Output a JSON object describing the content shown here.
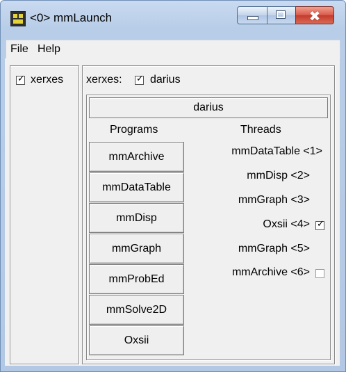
{
  "window": {
    "title": "<0> mmLaunch",
    "app_icon": "mm-app-icon"
  },
  "titlebar_buttons": {
    "minimize": "minimize-icon",
    "maximize": "maximize-icon",
    "close_glyph": "✖"
  },
  "menu": {
    "items": [
      "File",
      "Help"
    ]
  },
  "hosts": [
    {
      "label": "xerxes",
      "checked": true
    }
  ],
  "host_panel": {
    "prefix": "xerxes:",
    "node_label": "darius",
    "node_checked": true
  },
  "node": {
    "header": "darius",
    "programs_heading": "Programs",
    "threads_heading": "Threads",
    "programs": [
      "mmArchive",
      "mmDataTable",
      "mmDisp",
      "mmGraph",
      "mmProbEd",
      "mmSolve2D",
      "Oxsii"
    ],
    "threads": [
      {
        "label": "mmDataTable <1>",
        "checkbox": null
      },
      {
        "label": "mmDisp <2>",
        "checkbox": null
      },
      {
        "label": "mmGraph <3>",
        "checkbox": null
      },
      {
        "label": "Oxsii <4>",
        "checkbox": true
      },
      {
        "label": "mmGraph <5>",
        "checkbox": null
      },
      {
        "label": "mmArchive <6>",
        "checkbox": false
      }
    ]
  }
}
